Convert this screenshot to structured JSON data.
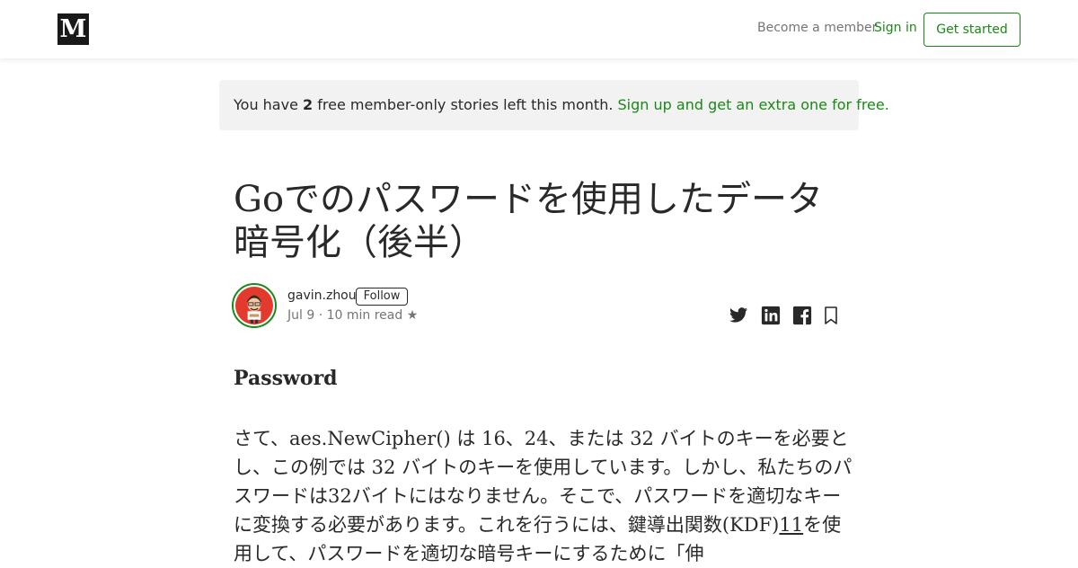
{
  "header": {
    "logo_text": "M",
    "become_member": "Become a member",
    "sign_in": "Sign in",
    "get_started": "Get started"
  },
  "banner": {
    "prefix": "You have ",
    "count": "2",
    "suffix": " free member-only stories left this month. ",
    "link": "Sign up and get an extra one for free."
  },
  "article": {
    "title_line1": "Goでのパスワードを使用したデータ",
    "title_line2": "暗号化（後半）",
    "author": "gavin.zhou",
    "follow": "Follow",
    "date": "Jul 9",
    "separator": " · ",
    "read_time": "10 min read",
    "star": " ★",
    "section_heading": "Password",
    "body_1": "さて、aes.NewCipher() は 16、24、または 32 バイトのキーを必要とし、この例では 32 バイトのキーを使用しています。しかし、私たちのパスワードは32バイトにはなりません。そこで、パスワードを適切なキーに変換する必要があります。これを行うには、鍵導出関数(KDF)",
    "body_link": "11",
    "body_2": "を使用して、パスワードを適切な暗号キーにするために「伸"
  },
  "share": {
    "icons": [
      "twitter-icon",
      "linkedin-icon",
      "facebook-icon",
      "bookmark-icon"
    ]
  },
  "colors": {
    "accent": "#1a8917",
    "text": "#292929",
    "muted": "#757575",
    "banner_bg": "#f2f2f2",
    "avatar_bg": "#e23a2c"
  }
}
